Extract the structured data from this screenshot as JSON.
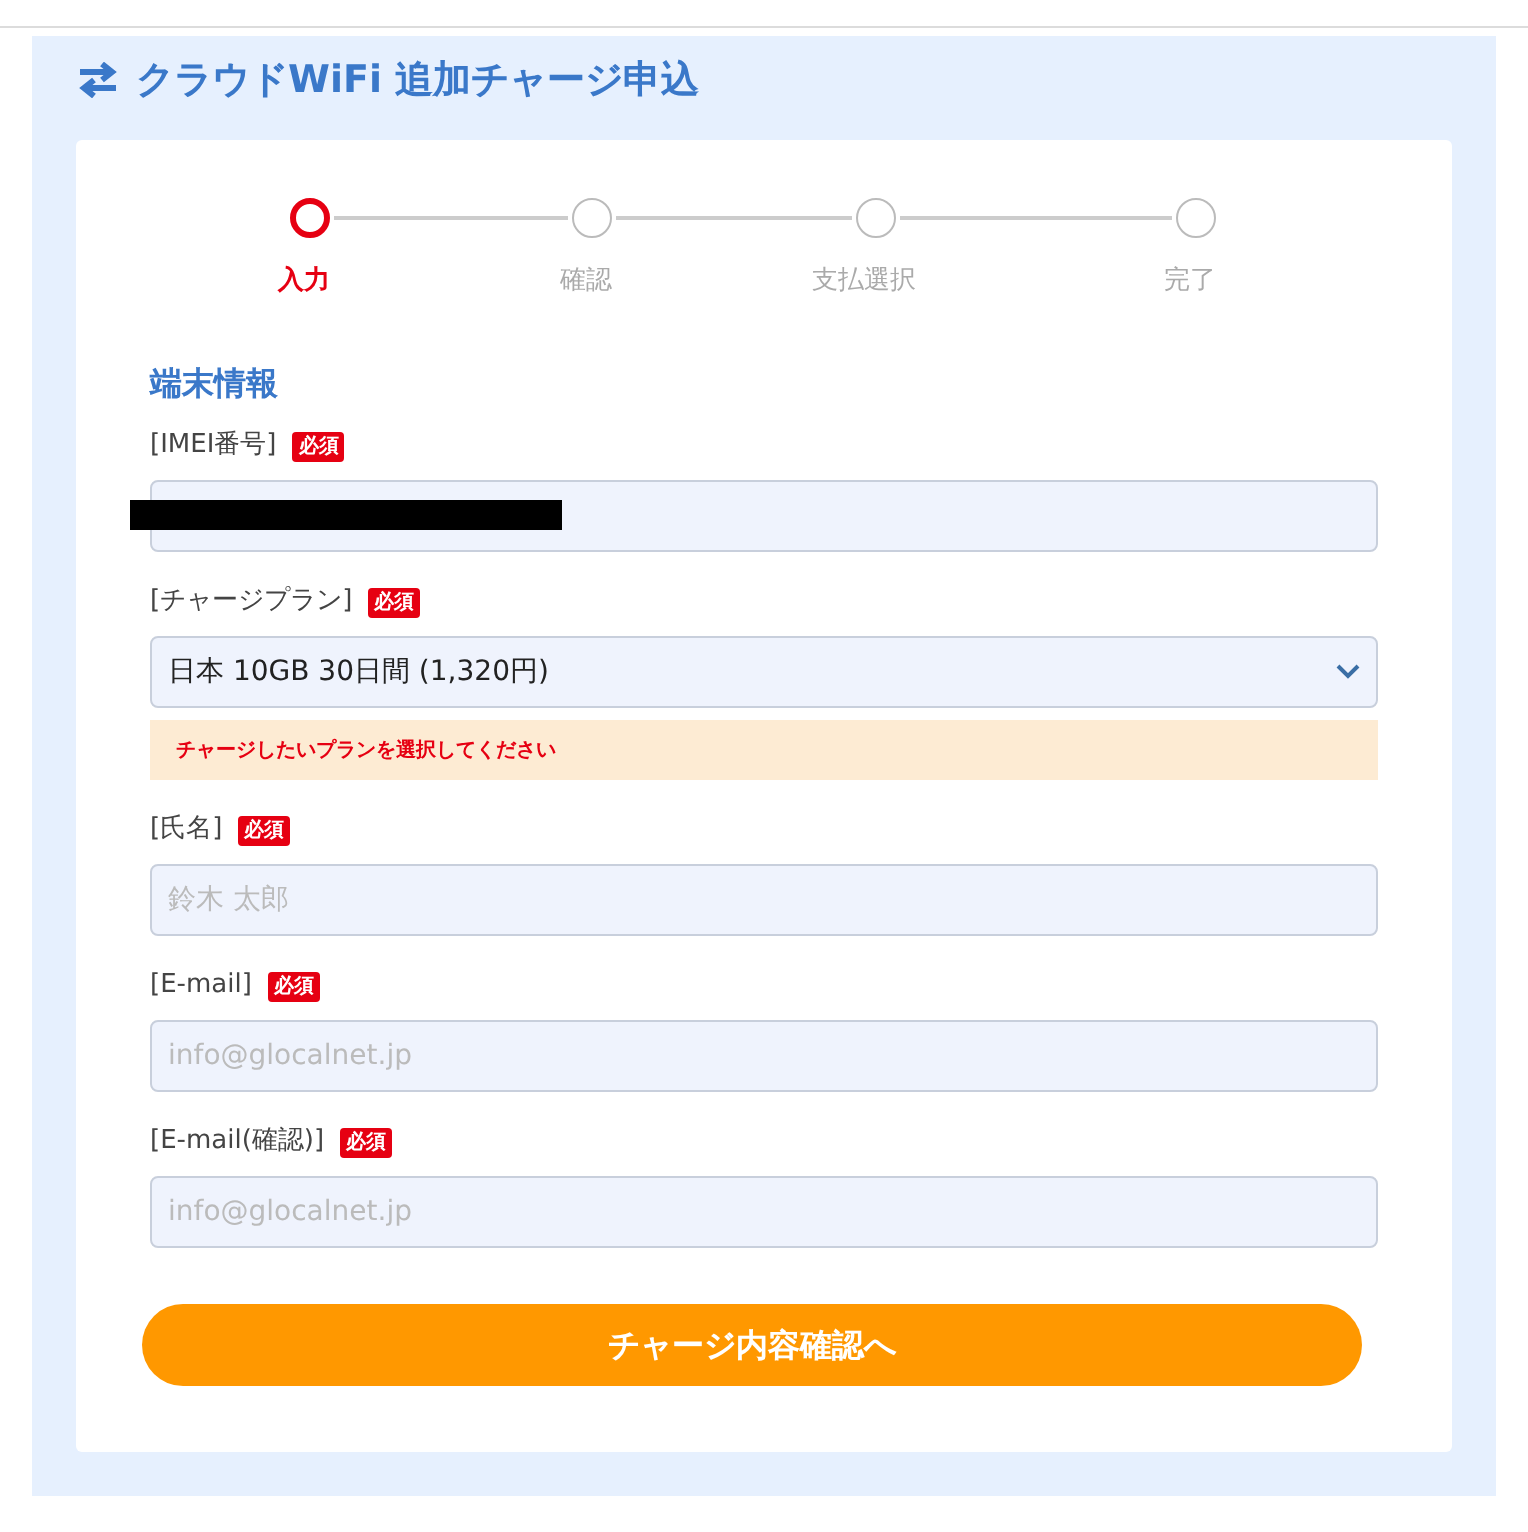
{
  "title": "クラウドWiFi 追加チャージ申込",
  "steps": [
    {
      "label": "入力",
      "selected": true
    },
    {
      "label": "確認",
      "selected": false
    },
    {
      "label": "支払選択",
      "selected": false
    },
    {
      "label": "完了",
      "selected": false
    }
  ],
  "section_title": "端末情報",
  "fields": [
    {
      "kind": "text",
      "label": "[IMEI番号]",
      "badge": "必須",
      "redacted": true
    },
    {
      "kind": "select",
      "label": "[チャージプラン]",
      "badge": "必須",
      "value": "日本 10GB 30日間 (1,320円)",
      "notice": "チャージしたいプランを選択してください"
    },
    {
      "kind": "text",
      "label": "[氏名]",
      "badge": "必須",
      "placeholder": "鈴木 太郎"
    },
    {
      "kind": "text",
      "label": "[E-mail]",
      "badge": "必須",
      "placeholder": "info@glocalnet.jp"
    },
    {
      "kind": "text",
      "label": "[E-mail(確認)]",
      "badge": "必須",
      "placeholder": "info@glocalnet.jp"
    }
  ],
  "submit_button": "チャージ内容確認へ"
}
